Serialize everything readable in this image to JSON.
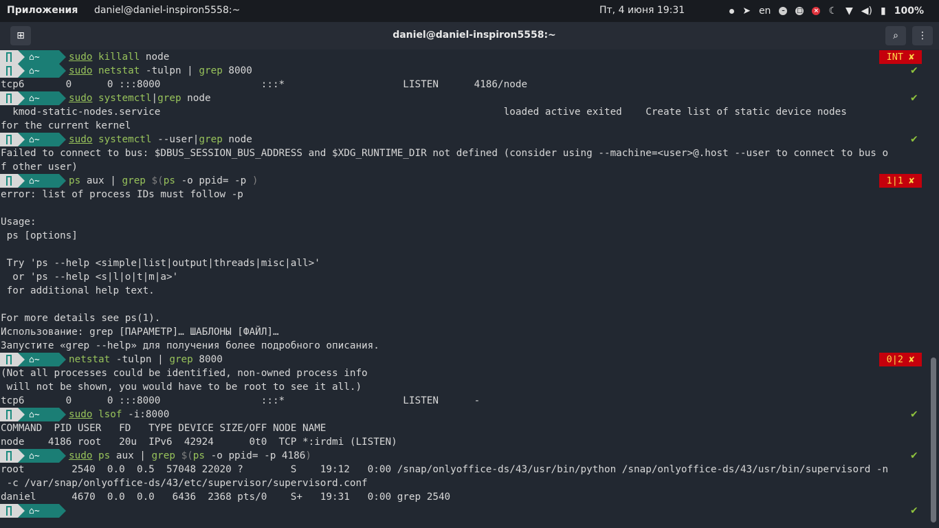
{
  "topbar": {
    "apps": "Приложения",
    "window_title": "daniel@daniel-inspiron5558:~",
    "clock": "Пт, 4 июня  19:31",
    "lang": "en",
    "battery": "100%"
  },
  "titlebar": {
    "title": "daniel@daniel-inspiron5558:~"
  },
  "prompt": {
    "home": "~"
  },
  "status": {
    "ok": "✔",
    "int": "INT ✘",
    "err1": "1|1 ✘",
    "err2": "0|2 ✘"
  },
  "cmds": [
    {
      "sudo": "sudo",
      "rest": [
        [
          "cmd",
          "killall"
        ],
        [
          "txt",
          " node"
        ]
      ]
    },
    {
      "sudo": "sudo",
      "rest": [
        [
          "cmd",
          "netstat"
        ],
        [
          "txt",
          " -tulpn | "
        ],
        [
          "cmd",
          "grep"
        ],
        [
          "txt",
          " 8000"
        ]
      ]
    }
  ],
  "output": {
    "o1": "tcp6       0      0 :::8000                 :::*                    LISTEN      4186/node",
    "o2": "  kmod-static-nodes.service                                                          loaded active exited    Create list of static device nodes",
    "o3": "for the current kernel",
    "o4": "Failed to connect to bus: $DBUS_SESSION_BUS_ADDRESS and $XDG_RUNTIME_DIR not defined (consider using --machine=<user>@.host --user to connect to bus o",
    "o5": "f other user)",
    "o6": "error: list of process IDs must follow -p",
    "o7": "Usage:",
    "o8": " ps [options]",
    "o9": " Try 'ps --help <simple|list|output|threads|misc|all>'",
    "o10": "  or 'ps --help <s|l|o|t|m|a>'",
    "o11": " for additional help text.",
    "o12": "For more details see ps(1).",
    "o13": "Использование: grep [ПАРАМЕТР]… ШАБЛОНЫ [ФАЙЛ]…",
    "o14": "Запустите «grep --help» для получения более подробного описания.",
    "o15": "(Not all processes could be identified, non-owned process info",
    "o16": " will not be shown, you would have to be root to see it all.)",
    "o17": "tcp6       0      0 :::8000                 :::*                    LISTEN      -",
    "o18": "COMMAND  PID USER   FD   TYPE DEVICE SIZE/OFF NODE NAME",
    "o19": "node    4186 root   20u  IPv6  42924      0t0  TCP *:irdmi (LISTEN)",
    "o20": "root        2540  0.0  0.5  57048 22020 ?        S    19:12   0:00 /snap/onlyoffice-ds/43/usr/bin/python /snap/onlyoffice-ds/43/usr/bin/supervisord -n",
    "o21": " -c /var/snap/onlyoffice-ds/43/etc/supervisor/supervisord.conf",
    "o22": "daniel      4670  0.0  0.0   6436  2368 pts/0    S+   19:31   0:00 grep 2540"
  },
  "colors": {
    "accent": "#1b7e75",
    "ok": "#8fc33d",
    "err_bg": "#c5000c",
    "cmd_green": "#98c35b"
  }
}
